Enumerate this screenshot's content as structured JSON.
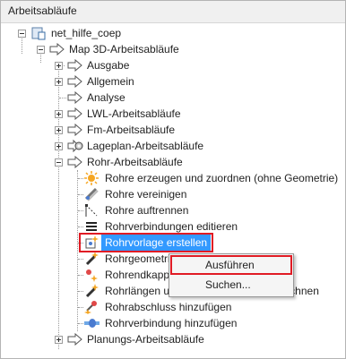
{
  "panel": {
    "title": "Arbeitsabläufe"
  },
  "tree": {
    "root": "net_hilfe_coep",
    "map": "Map 3D-Arbeitsabläufe",
    "categories": [
      "Ausgabe",
      "Allgemein",
      "Analyse",
      "LWL-Arbeitsabläufe",
      "Fm-Arbeitsabläufe",
      "Lageplan-Arbeitsabläufe",
      "Rohr-Arbeitsabläufe"
    ],
    "rohr_items": [
      "Rohre erzeugen und zuordnen (ohne Geometrie)",
      "Rohre vereinigen",
      "Rohre auftrennen",
      "Rohrverbindungen editieren",
      "Rohrvorlage erstellen",
      "Rohrgeometrie",
      "Rohrendkappe",
      "Rohrlängen und Kabellängen neu berechnen",
      "Rohrabschluss hinzufügen",
      "Rohrverbindung hinzufügen"
    ],
    "last_category": "Planungs-Arbeitsabläufe"
  },
  "context_menu": {
    "items": [
      "Ausführen",
      "Suchen..."
    ]
  },
  "colors": {
    "selection": "#3399ff",
    "highlight": "#e01b24"
  }
}
